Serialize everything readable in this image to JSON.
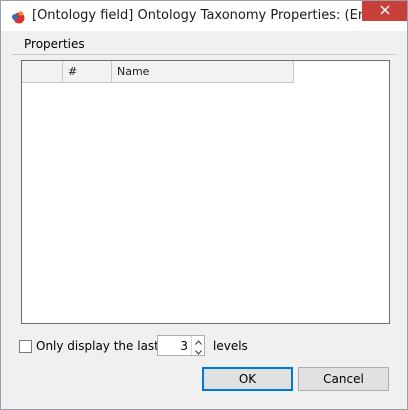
{
  "window": {
    "title": "[Ontology field] Ontology Taxonomy Properties: (Englis..."
  },
  "tabs": [
    {
      "label": "Properties"
    }
  ],
  "grid": {
    "columns": [
      "",
      "#",
      "Name"
    ],
    "rows": []
  },
  "display_filter": {
    "checkbox_label": "Only display the last",
    "checked": false,
    "value": "3",
    "suffix": "levels"
  },
  "buttons": {
    "ok": "OK",
    "cancel": "Cancel"
  },
  "icons": {
    "app": "ontology-app-icon",
    "close": "close-icon",
    "spin_up": "chevron-up-icon",
    "spin_down": "chevron-down-icon"
  },
  "colors": {
    "close_button": "#c7413a",
    "default_button_border": "#0078d7"
  }
}
